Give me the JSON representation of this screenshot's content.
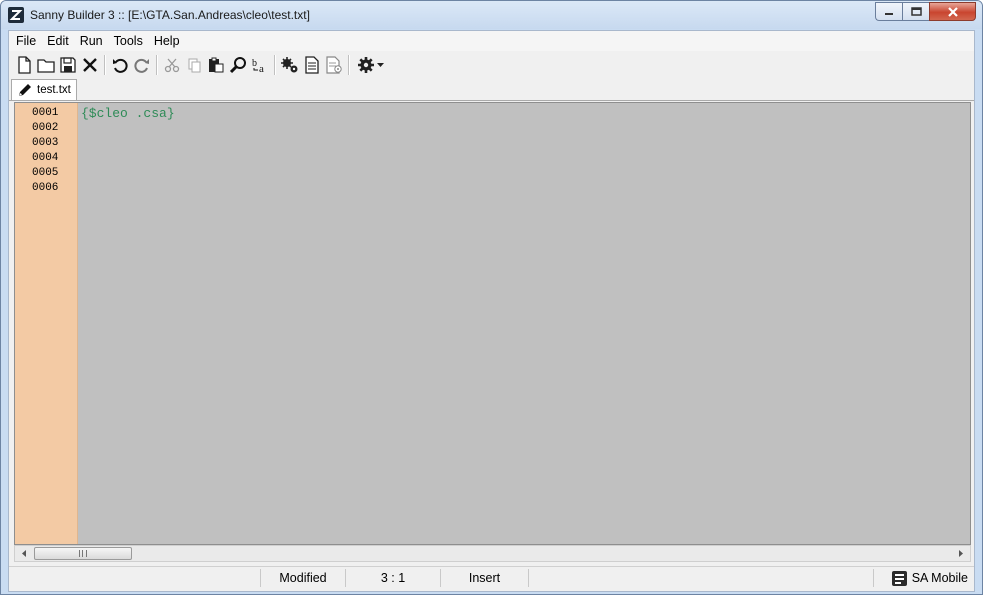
{
  "window": {
    "title": "Sanny Builder 3 :: [E:\\GTA.San.Andreas\\cleo\\test.txt]",
    "icon": "sanny-builder-app-icon"
  },
  "menu": [
    "File",
    "Edit",
    "Run",
    "Tools",
    "Help"
  ],
  "toolbar": {
    "buttons": [
      "new-file",
      "open-file",
      "save-file",
      "close-file",
      "undo",
      "redo",
      "cut",
      "copy",
      "paste",
      "find",
      "replace",
      "compile",
      "compile-run",
      "decompile",
      "options"
    ]
  },
  "tabs": [
    {
      "label": "test.txt",
      "icon": "pencil-icon"
    }
  ],
  "editor": {
    "line_numbers": [
      "0001",
      "0002",
      "0003",
      "0004",
      "0005",
      "0006"
    ],
    "lines": [
      "{$cleo .csa}",
      "",
      "",
      "",
      "",
      ""
    ],
    "colors": {
      "gutter": "#f3caa4",
      "background": "#c0c0c0",
      "directive": "#2e8b57"
    }
  },
  "status": {
    "state": "Modified",
    "position": "3 :  1",
    "mode": "Insert",
    "game": "SA Mobile"
  }
}
